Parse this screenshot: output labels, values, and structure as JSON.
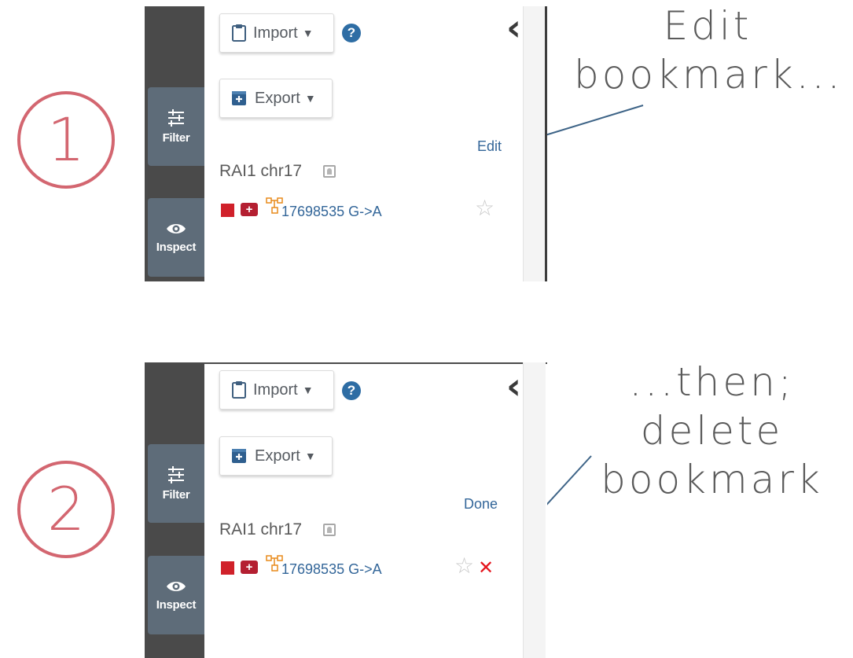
{
  "annotations": {
    "step1_number": "1",
    "step2_number": "2",
    "step1_line1": "Edit",
    "step1_line2": "bookmark...",
    "step2_line1": "...then; delete",
    "step2_line2": "bookmark"
  },
  "colors": {
    "accent_red": "#d36670",
    "link_blue": "#336699",
    "sidebar_button": "#5e6c79",
    "delete_red": "#e5151d"
  },
  "panel1": {
    "import_label": "Import",
    "export_label": "Export",
    "help_symbol": "?",
    "edit_label": "Edit",
    "sidebar": {
      "filter_label": "Filter",
      "inspect_label": "Inspect"
    },
    "bookmark": {
      "title": "RAI1 chr17",
      "variant": "17698535 G->A"
    }
  },
  "panel2": {
    "import_label": "Import",
    "export_label": "Export",
    "help_symbol": "?",
    "done_label": "Done",
    "sidebar": {
      "filter_label": "Filter",
      "inspect_label": "Inspect"
    },
    "bookmark": {
      "title": "RAI1 chr17",
      "variant": "17698535 G->A"
    }
  },
  "icons": [
    "clipboard-icon",
    "export-icon",
    "help-icon",
    "chevron-left-icon",
    "filter-sliders-icon",
    "eye-icon",
    "person-card-icon",
    "red-square-icon",
    "medical-kit-icon",
    "network-icon",
    "star-icon",
    "delete-x-icon"
  ]
}
